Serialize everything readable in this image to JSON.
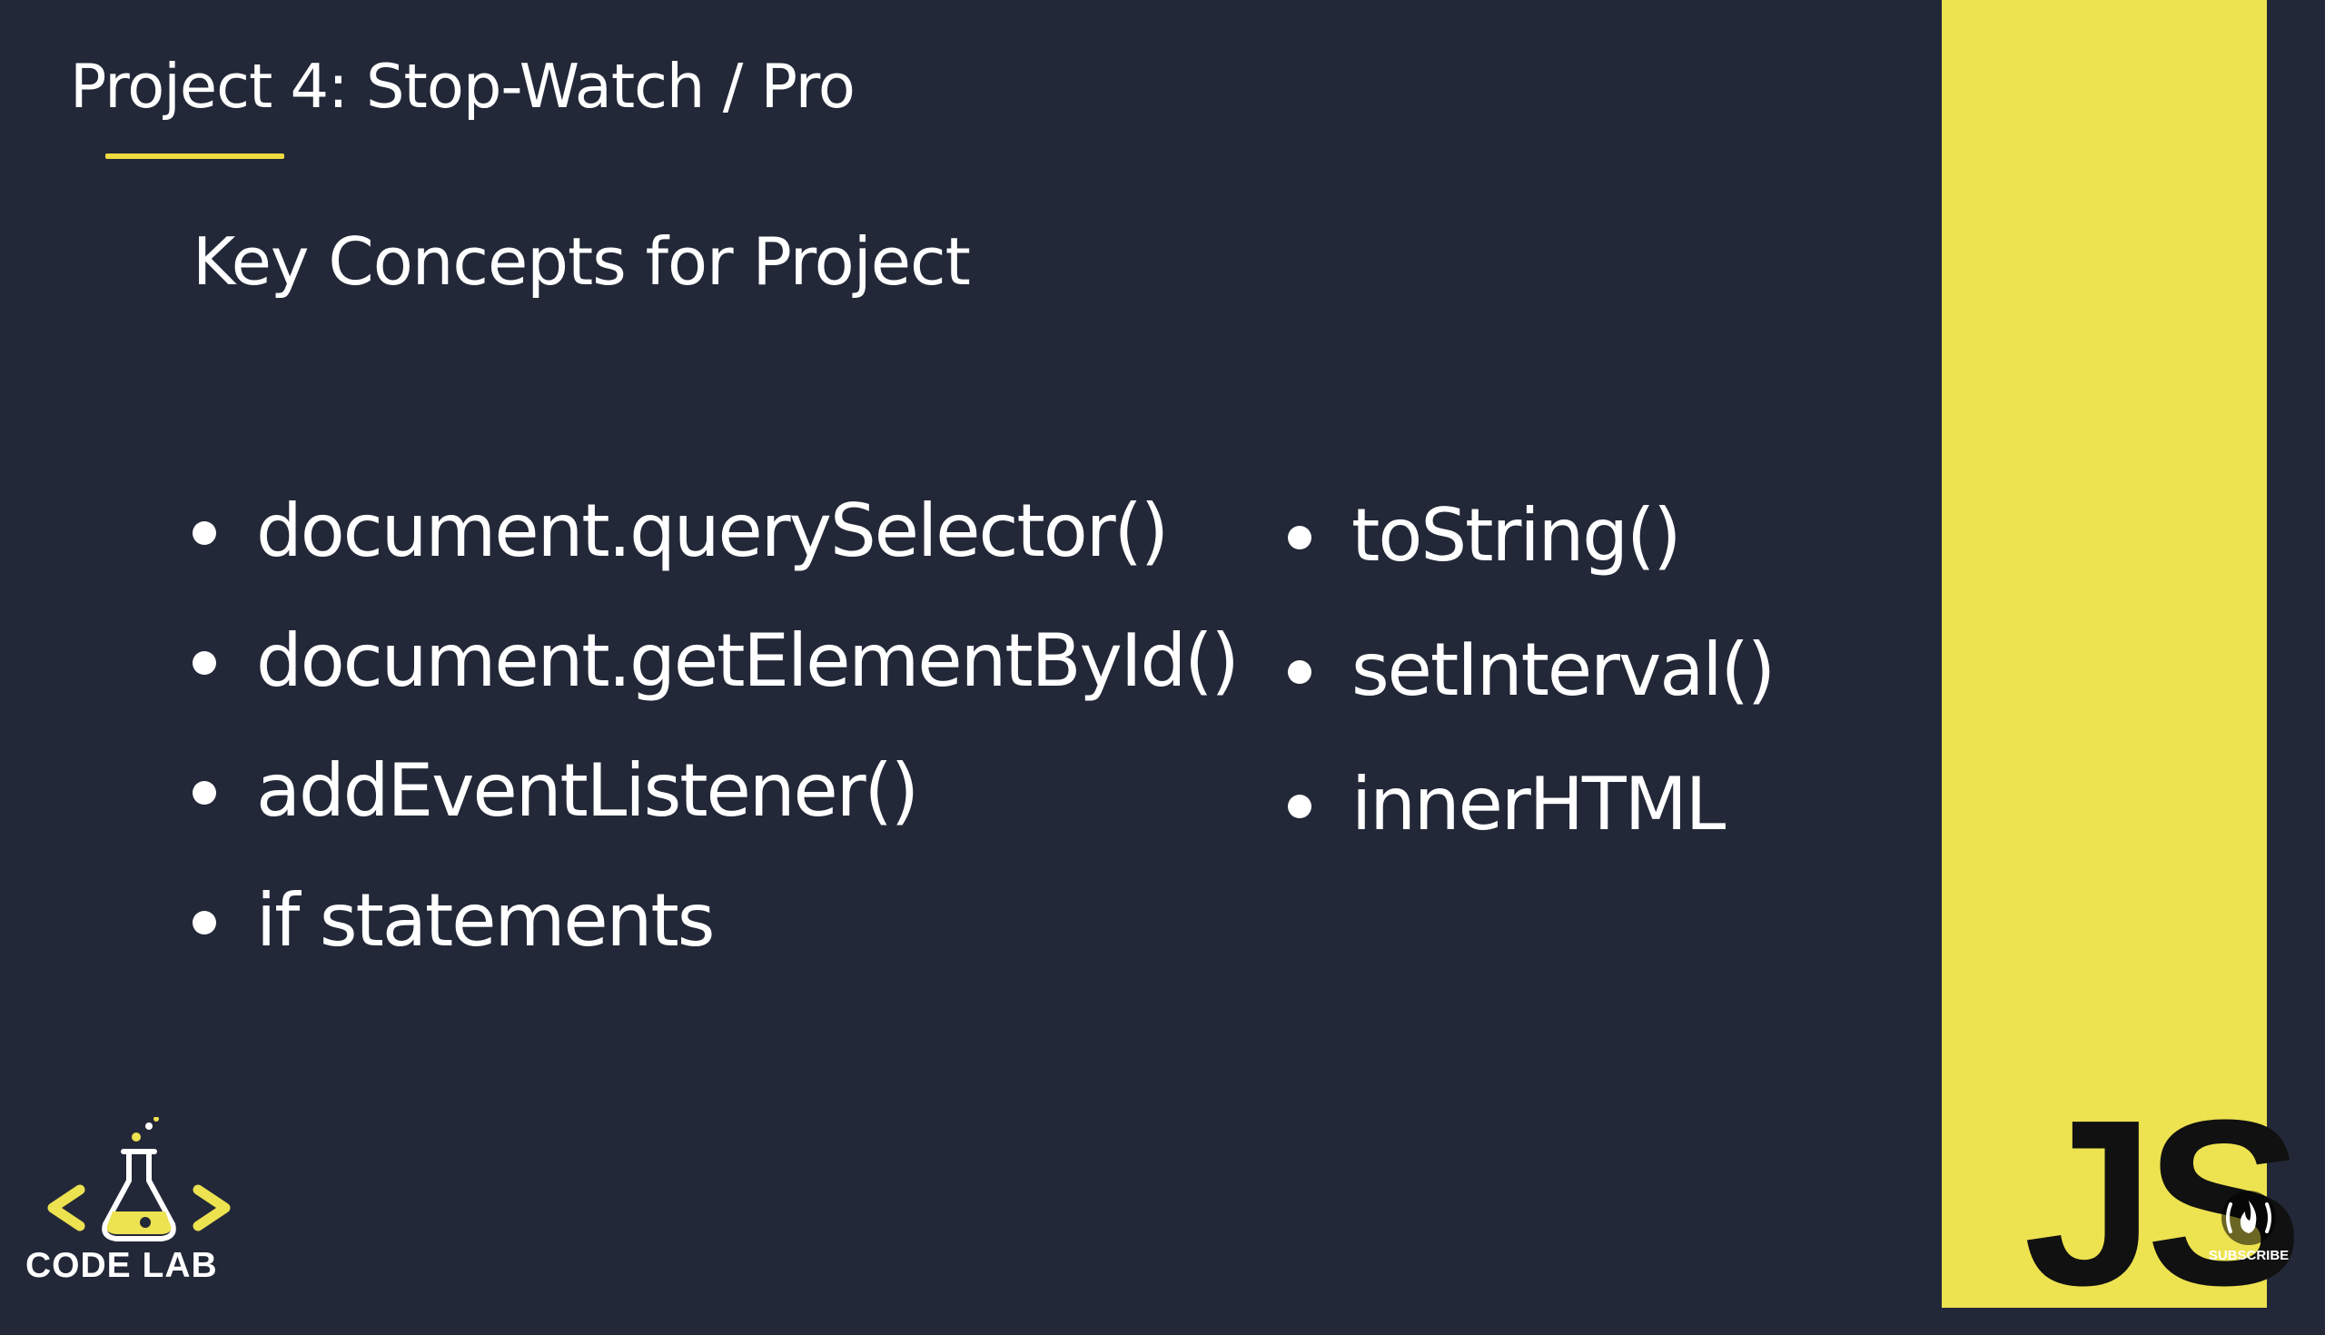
{
  "slide": {
    "title": "Project 4: Stop-Watch / Pro",
    "subheading": "Key Concepts for Project",
    "left_concepts": [
      "document.querySelector()",
      "document.getElementById()",
      "addEventListener()",
      "if statements"
    ],
    "right_concepts": [
      "toString()",
      "setInterval()",
      "innerHTML"
    ]
  },
  "branding": {
    "js_logo": "JS",
    "codelab_label": "CODE LAB",
    "subscribe_label": "SUBSCRIBE"
  },
  "colors": {
    "background": "#232838",
    "accent_yellow": "#ede250",
    "underline_yellow": "#eddc3f",
    "text": "#ffffff"
  },
  "icons": {
    "codelab": "flask-code-icon",
    "subscribe": "flame-icon"
  }
}
